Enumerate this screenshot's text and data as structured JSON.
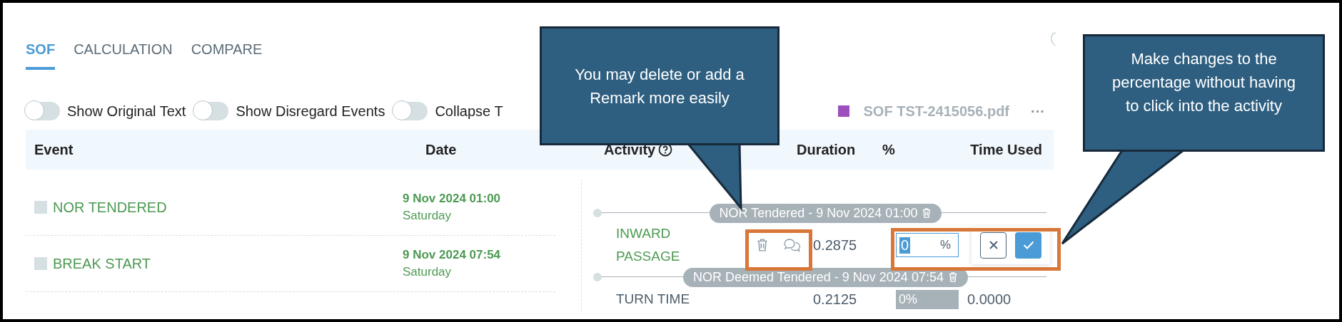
{
  "tabs": [
    {
      "label": "SOF",
      "selected": true
    },
    {
      "label": "CALCULATION",
      "selected": false
    },
    {
      "label": "COMPARE",
      "selected": false
    }
  ],
  "toggles": [
    {
      "label": "Show Original Text",
      "on": false
    },
    {
      "label": "Show Disregard Events",
      "on": false
    },
    {
      "label": "Collapse T",
      "on": false
    }
  ],
  "file": {
    "name": "SOF TST-2415056.pdf",
    "more": "···"
  },
  "table": {
    "columns": [
      "Event",
      "Date",
      "Activity",
      "Duration",
      "%",
      "Time Used"
    ],
    "events": [
      {
        "name": "NOR TENDERED",
        "date": "9 Nov 2024 01:00",
        "day": "Saturday"
      },
      {
        "name": "BREAK START",
        "date": "9 Nov 2024 07:54",
        "day": "Saturday"
      }
    ],
    "activities": [
      {
        "kind": "marker",
        "label": "NOR Tendered - 9 Nov 2024 01:00"
      },
      {
        "kind": "activity",
        "name": "INWARD PASSAGE",
        "duration": "0.2875",
        "editing": true,
        "value": "0",
        "unit": "%"
      },
      {
        "kind": "marker",
        "label": "NOR Deemed Tendered - 9 Nov 2024 07:54"
      },
      {
        "kind": "activity",
        "name": "TURN TIME",
        "duration": "0.2125",
        "editing": false,
        "percent": "0%",
        "time_used": "0.0000"
      }
    ]
  },
  "callouts": [
    {
      "text": "You may delete or add a Remark more easily"
    },
    {
      "text": "Make changes to the percentage without having to click into the activity"
    }
  ]
}
